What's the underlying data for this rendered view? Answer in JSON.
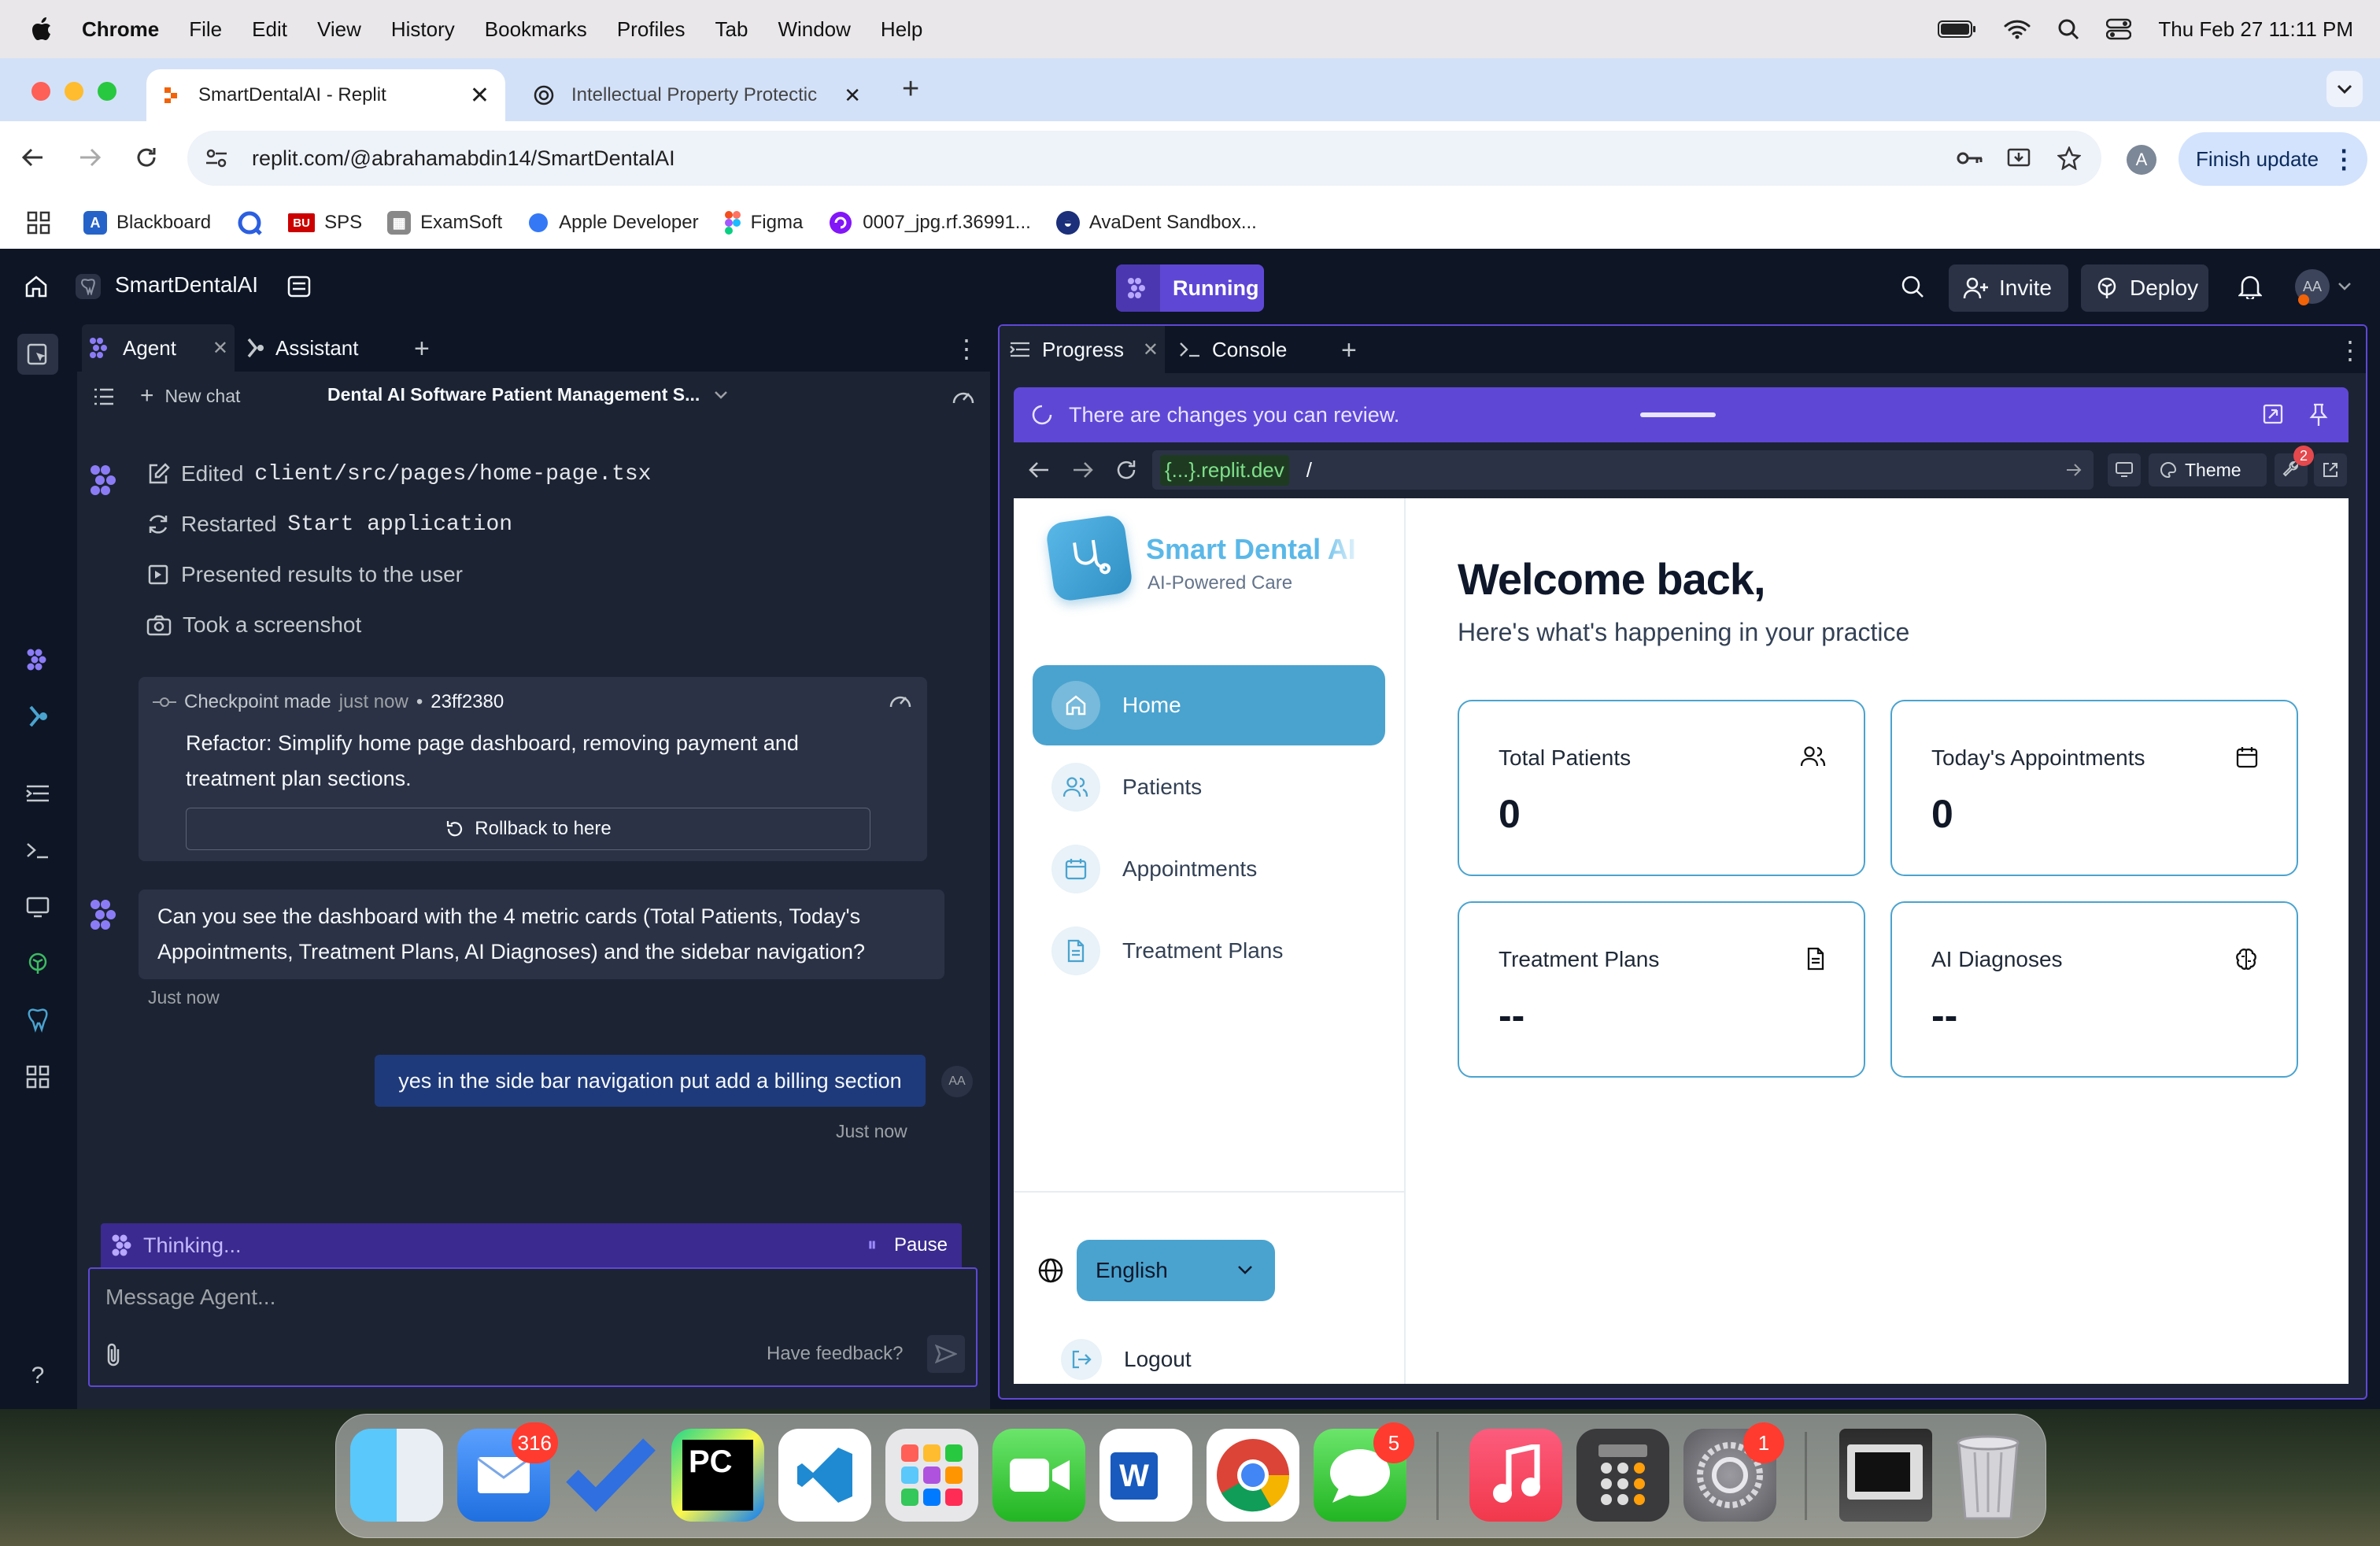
{
  "menubar": {
    "app": "Chrome",
    "items": [
      "File",
      "Edit",
      "View",
      "History",
      "Bookmarks",
      "Profiles",
      "Tab",
      "Window",
      "Help"
    ],
    "datetime": "Thu Feb 27  11:11 PM"
  },
  "browser": {
    "tabs": [
      {
        "title": "SmartDentalAI - Replit"
      },
      {
        "title": "Intellectual Property Protectic"
      }
    ],
    "url": "replit.com/@abrahamabdin14/SmartDentalAI",
    "profile_initial": "A",
    "finish_update": "Finish update",
    "bookmarks": [
      "Blackboard",
      "SPS",
      "ExamSoft",
      "Apple Developer",
      "Figma",
      "0007_jpg.rf.36991...",
      "AvaDent Sandbox..."
    ]
  },
  "replit": {
    "project_name": "SmartDentalAI",
    "run_status": "Running",
    "invite": "Invite",
    "deploy": "Deploy",
    "avatar": "AA",
    "left_tabs": [
      "Agent",
      "Assistant"
    ],
    "new_chat": "New chat",
    "chat_title": "Dental AI Software Patient Management S...",
    "actions": [
      {
        "verb": "Edited",
        "target": "client/src/pages/home-page.tsx"
      },
      {
        "verb": "Restarted",
        "target": "Start application"
      },
      {
        "verb": "Presented results to the user",
        "target": ""
      },
      {
        "verb": "Took a screenshot",
        "target": ""
      }
    ],
    "checkpoint": {
      "label": "Checkpoint made",
      "time": "just now",
      "hash": "23ff2380",
      "message": "Refactor: Simplify home page dashboard, removing payment and treatment plan sections.",
      "rollback": "Rollback to here"
    },
    "agent_message": "Can you see the dashboard with the 4 metric cards (Total Patients, Today's Appointments, Treatment Plans, AI Diagnoses) and the sidebar navigation?",
    "agent_time": "Just now",
    "user_message": "yes in the side bar navigation put add a billing section",
    "user_time": "Just now",
    "user_avatar": "AA",
    "thinking": "Thinking...",
    "pause": "Pause",
    "input_placeholder": "Message Agent...",
    "feedback": "Have feedback?",
    "right_tabs": [
      "Progress",
      "Console"
    ],
    "review_banner": "There are changes you can review.",
    "preview_domain": "{...}.replit.dev",
    "preview_path": "/",
    "theme": "Theme",
    "devtools_badge": "2"
  },
  "dental": {
    "brand": "Smart Dental AI",
    "tagline": "AI-Powered Care",
    "nav": [
      "Home",
      "Patients",
      "Appointments",
      "Treatment Plans"
    ],
    "welcome": "Welcome back,",
    "subtitle": "Here's what's happening in your practice",
    "cards": [
      {
        "title": "Total Patients",
        "value": "0"
      },
      {
        "title": "Today's Appointments",
        "value": "0"
      },
      {
        "title": "Treatment Plans",
        "value": "--"
      },
      {
        "title": "AI Diagnoses",
        "value": "--"
      }
    ],
    "language": "English",
    "logout": "Logout"
  },
  "dock": {
    "badges": {
      "mail": "316",
      "messages": "5",
      "settings": "1"
    }
  },
  "colors": {
    "replit_bg": "#0e1525",
    "replit_panel": "#1c2333",
    "accent_purple": "#5f47d6",
    "dental_blue": "#4aa3cf",
    "chrome_tab_bg": "#d3e1f8"
  }
}
